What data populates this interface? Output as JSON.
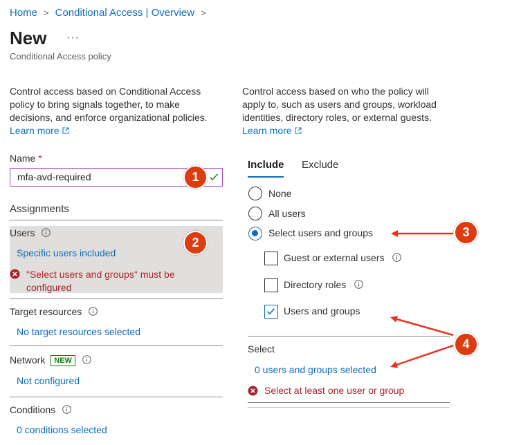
{
  "breadcrumb": {
    "home": "Home",
    "sep": ">",
    "parent": "Conditional Access | Overview"
  },
  "page": {
    "title": "New",
    "more": "···",
    "subtitle": "Conditional Access policy"
  },
  "left": {
    "description": "Control access based on Conditional Access policy to bring signals together, to make decisions, and enforce organizational policies.",
    "learn_more": "Learn more",
    "name_label": "Name",
    "required_mark": "*",
    "name_value": "mfa-avd-required",
    "assignments_heading": "Assignments",
    "users_label": "Users",
    "users_value": "Specific users included",
    "users_error": "\"Select users and groups\" must be configured",
    "target_label": "Target resources",
    "target_value": "No target resources selected",
    "network_label": "Network",
    "network_badge": "NEW",
    "network_value": "Not configured",
    "conditions_label": "Conditions",
    "conditions_value": "0 conditions selected"
  },
  "right": {
    "description": "Control access based on who the policy will apply to, such as users and groups, workload identities, directory roles, or external guests.",
    "learn_more": "Learn more",
    "tabs": [
      "Include",
      "Exclude"
    ],
    "radios": [
      {
        "label": "None",
        "selected": false
      },
      {
        "label": "All users",
        "selected": false
      },
      {
        "label": "Select users and groups",
        "selected": true
      }
    ],
    "checkboxes": [
      {
        "label": "Guest or external users",
        "checked": false
      },
      {
        "label": "Directory roles",
        "checked": false
      },
      {
        "label": "Users and groups",
        "checked": true
      }
    ],
    "select_label": "Select",
    "select_value": "0 users and groups selected",
    "select_error": "Select at least one user or group"
  },
  "annotations": {
    "badge1": "1",
    "badge2": "2",
    "badge3": "3",
    "badge4": "4"
  },
  "colors": {
    "accent": "#0f6cbd",
    "error": "#a4262c",
    "badge": "#dd3b10",
    "arrow": "#e8321e",
    "new_badge": "#107c10"
  },
  "icons": [
    "chevron-right-icon",
    "more-icon",
    "external-link-icon",
    "checkmark-icon",
    "info-icon",
    "error-icon",
    "arrow-icon"
  ]
}
